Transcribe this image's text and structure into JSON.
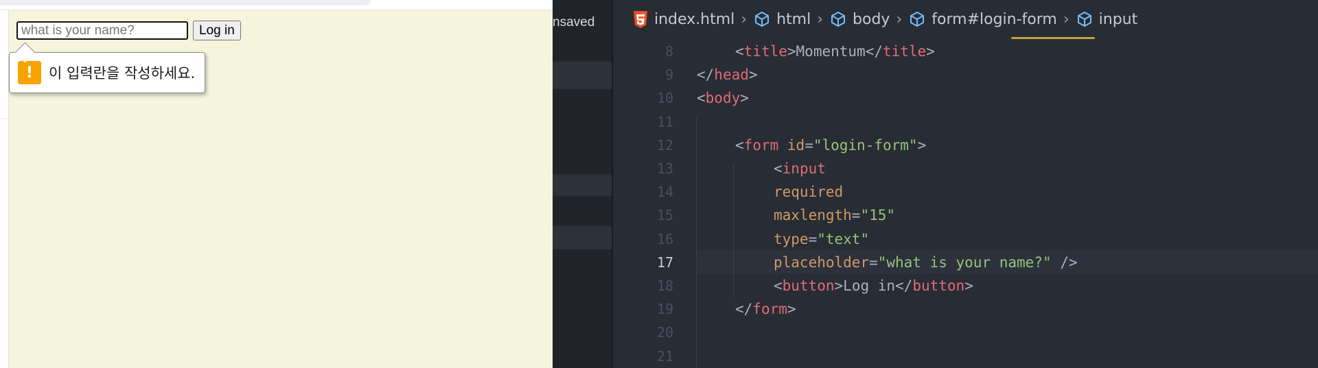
{
  "browser": {
    "input": {
      "placeholder": "what is your name?",
      "value": ""
    },
    "button_label": "Log in",
    "validation_message": "이 입력란을 작성하세요.",
    "validation_icon": "!",
    "background_color": "#f5f5dc"
  },
  "editor": {
    "unsaved_label": "nsaved",
    "breadcrumb": [
      {
        "label": "index.html",
        "icon": "html5-icon"
      },
      {
        "label": "html",
        "icon": "cube-icon"
      },
      {
        "label": "body",
        "icon": "cube-icon"
      },
      {
        "label": "form#login-form",
        "icon": "cube-icon"
      },
      {
        "label": "input",
        "icon": "cube-icon"
      }
    ],
    "active_line": 17,
    "lines": [
      {
        "num": "8",
        "indent": 1,
        "tokens": [
          {
            "t": "p",
            "v": "<"
          },
          {
            "t": "t",
            "v": "title"
          },
          {
            "t": "p",
            "v": ">"
          },
          {
            "t": "x",
            "v": "Momentum"
          },
          {
            "t": "p",
            "v": "</"
          },
          {
            "t": "t",
            "v": "title"
          },
          {
            "t": "p",
            "v": ">"
          }
        ]
      },
      {
        "num": "9",
        "indent": 0,
        "tokens": [
          {
            "t": "p",
            "v": "</"
          },
          {
            "t": "t",
            "v": "head"
          },
          {
            "t": "p",
            "v": ">"
          }
        ]
      },
      {
        "num": "10",
        "indent": 0,
        "tokens": [
          {
            "t": "p",
            "v": "<"
          },
          {
            "t": "t",
            "v": "body"
          },
          {
            "t": "p",
            "v": ">"
          }
        ]
      },
      {
        "num": "11",
        "indent": 0,
        "tokens": []
      },
      {
        "num": "12",
        "indent": 1,
        "tokens": [
          {
            "t": "p",
            "v": "<"
          },
          {
            "t": "t",
            "v": "form"
          },
          {
            "t": "p",
            "v": " "
          },
          {
            "t": "a",
            "v": "id"
          },
          {
            "t": "p",
            "v": "="
          },
          {
            "t": "s",
            "v": "\"login-form\""
          },
          {
            "t": "p",
            "v": ">"
          }
        ]
      },
      {
        "num": "13",
        "indent": 2,
        "tokens": [
          {
            "t": "p",
            "v": "<"
          },
          {
            "t": "t",
            "v": "input"
          }
        ]
      },
      {
        "num": "14",
        "indent": 2,
        "tokens": [
          {
            "t": "a",
            "v": "required"
          }
        ]
      },
      {
        "num": "15",
        "indent": 2,
        "tokens": [
          {
            "t": "a",
            "v": "maxlength"
          },
          {
            "t": "p",
            "v": "="
          },
          {
            "t": "s",
            "v": "\"15\""
          }
        ]
      },
      {
        "num": "16",
        "indent": 2,
        "tokens": [
          {
            "t": "a",
            "v": "type"
          },
          {
            "t": "p",
            "v": "="
          },
          {
            "t": "s",
            "v": "\"text\""
          }
        ]
      },
      {
        "num": "17",
        "indent": 2,
        "tokens": [
          {
            "t": "a",
            "v": "placeholder"
          },
          {
            "t": "p",
            "v": "="
          },
          {
            "t": "s",
            "v": "\"what is your name?\""
          },
          {
            "t": "p",
            "v": " />"
          }
        ]
      },
      {
        "num": "18",
        "indent": 2,
        "tokens": [
          {
            "t": "p",
            "v": "<"
          },
          {
            "t": "t",
            "v": "button"
          },
          {
            "t": "p",
            "v": ">"
          },
          {
            "t": "x",
            "v": "Log in"
          },
          {
            "t": "p",
            "v": "</"
          },
          {
            "t": "t",
            "v": "button"
          },
          {
            "t": "p",
            "v": ">"
          }
        ]
      },
      {
        "num": "19",
        "indent": 1,
        "tokens": [
          {
            "t": "p",
            "v": "</"
          },
          {
            "t": "t",
            "v": "form"
          },
          {
            "t": "p",
            "v": ">"
          }
        ]
      },
      {
        "num": "20",
        "indent": 0,
        "tokens": []
      },
      {
        "num": "21",
        "indent": 0,
        "tokens": []
      }
    ],
    "colors": {
      "tag": "#e06c75",
      "attribute": "#d19a66",
      "string": "#98c379",
      "punctuation": "#abb2bf"
    }
  }
}
